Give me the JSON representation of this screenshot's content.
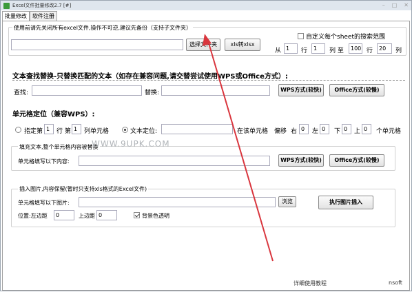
{
  "window": {
    "title": "Excel文件批量修改2.7 [#]"
  },
  "tabs": [
    "批量修改",
    "软件注册"
  ],
  "folder": {
    "group_label": "使用前请先关闭所有excel文件,操作不可逆,建议先备份（支持子文件夹）",
    "path_value": "",
    "select_button": "选择文件夹",
    "xls_button": "xls转xlsx",
    "custom_sheet_label": "自定义每个sheet的搜索范围",
    "range": {
      "from_label": "从",
      "from_row": "1",
      "row_label": "行",
      "from_col": "1",
      "col_to_label": "列 至",
      "to_row": "100",
      "row2_label": "行",
      "to_col": "20",
      "col2_label": "列"
    }
  },
  "replace": {
    "title": "文本查找替换-只替换匹配的文本（如存在兼容问题,请交替尝试使用WPS或Office方式）:",
    "find_label": "查找:",
    "find_value": "",
    "replace_label": "替换:",
    "replace_value": "",
    "wps_button": "WPS方式(较快)",
    "office_button": "Office方式(较慢)"
  },
  "cell": {
    "title": "单元格定位（兼容WPS）:",
    "opt1_label": "指定第",
    "row_value": "1",
    "row_label": "行 第",
    "col_value": "1",
    "col_label": "列单元格",
    "opt2_label": "文本定位:",
    "text_value": "",
    "offset_label": "在该单元格　偏移",
    "right_label": "右",
    "right_value": "0",
    "left_label": "左",
    "left_value": "0",
    "down_label": "下",
    "down_value": "0",
    "up_label": "上",
    "up_value": "0",
    "unit_label": "个单元格"
  },
  "fill": {
    "group_label": "填充文本,整个单元格内容被替换",
    "content_label": "单元格填写以下内容:",
    "content_value": "",
    "wps_button": "WPS方式(较快)",
    "office_button": "Office方式(较慢)"
  },
  "watermark": "WWW.9UPK.COM",
  "image": {
    "group_label": "插入图片,内容保留(暂时只支持xls格式的Excel文件)",
    "image_label": "单元格填写以下图片:",
    "image_value": "",
    "browse_button": "浏览",
    "exec_button": "执行图片插入",
    "pos_label": "位置:左边距",
    "left_value": "0",
    "top_label": "上边距",
    "top_value": "0",
    "transparent_label": "背景色透明"
  },
  "footer": {
    "help_link": "详细使用教程",
    "brand": "nsoft"
  },
  "colors": {
    "arrow": "#d9363e"
  }
}
